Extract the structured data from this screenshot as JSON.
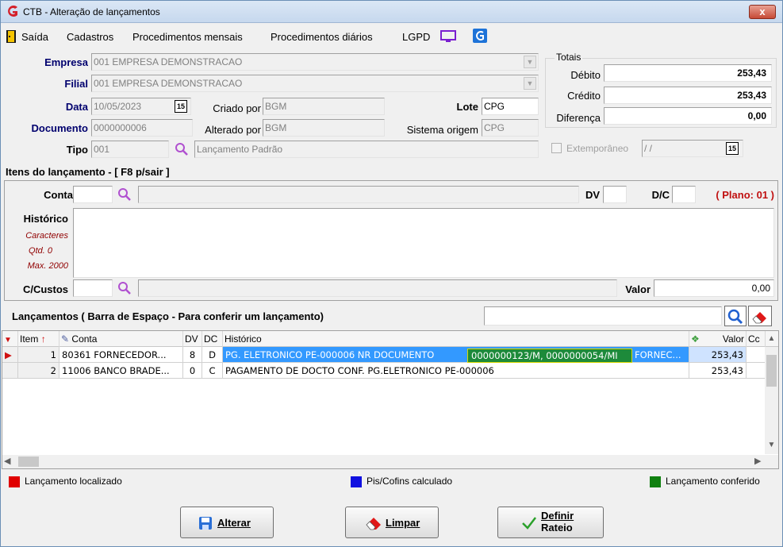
{
  "window": {
    "title": "CTB - Alteração de lançamentos",
    "close_label": "x"
  },
  "menu": [
    "Saída",
    "Cadastros",
    "Procedimentos mensais",
    "Procedimentos diários",
    "LGPD"
  ],
  "header": {
    "empresa_label": "Empresa",
    "empresa_value": "001 EMPRESA DEMONSTRACAO",
    "filial_label": "Filial",
    "filial_value": "001 EMPRESA DEMONSTRACAO",
    "data_label": "Data",
    "data_value": "10/05/2023",
    "criado_por_label": "Criado por",
    "criado_por_value": "BGM",
    "lote_label": "Lote",
    "lote_value": "CPG",
    "documento_label": "Documento",
    "documento_value": "0000000006",
    "alterado_por_label": "Alterado por",
    "alterado_por_value": "BGM",
    "sistema_origem_label": "Sistema origem",
    "sistema_origem_value": "CPG",
    "tipo_label": "Tipo",
    "tipo_value": "001",
    "tipo_desc": "Lançamento Padrão",
    "calendar_glyph": "15"
  },
  "totais": {
    "title": "Totais",
    "debito_label": "Débito",
    "debito_value": "253,43",
    "credito_label": "Crédito",
    "credito_value": "253,43",
    "diferenca_label": "Diferença",
    "diferenca_value": "0,00"
  },
  "extemporaneo": {
    "label": "Extemporâneo",
    "date_value": "/ /"
  },
  "itens": {
    "section_title": "Itens do lançamento - [ F8 p/sair ]",
    "conta_label": "Conta",
    "dv_label": "DV",
    "dc_label": "D/C",
    "plano_label": "( Plano: 01 )",
    "historico_label": "Histórico",
    "caracteres_label": "Caracteres",
    "qtd_label": "Qtd. 0",
    "max_label": "Max. 2000",
    "ccustos_label": "C/Custos",
    "valor_label": "Valor",
    "valor_value": "0,00"
  },
  "lancamentos": {
    "section_title": "Lançamentos ( Barra de Espaço - Para conferir um lançamento)",
    "search_value": "",
    "columns": [
      "Item",
      "Conta",
      "DV",
      "DC",
      "Histórico",
      "Valor",
      "Cc"
    ],
    "rows": [
      {
        "item": "1",
        "conta": "80361 FORNECEDOR...",
        "dv": "8",
        "dc": "D",
        "historico": "PG. ELETRONICO PE-000006  NR DOCUMENTO",
        "tooltip": "0000000123/M, 0000000054/MI",
        "historico_tail": "FORNEC...",
        "valor": "253,43"
      },
      {
        "item": "2",
        "conta": "11006 BANCO BRADE...",
        "dv": "0",
        "dc": "C",
        "historico": "PAGAMENTO DE DOCTO CONF. PG.ELETRONICO PE-000006",
        "tooltip": "",
        "historico_tail": "",
        "valor": "253,43"
      }
    ]
  },
  "legend": [
    {
      "label": "Lançamento localizado",
      "color": "#e00000"
    },
    {
      "label": "Pis/Cofins calculado",
      "color": "#1010e0"
    },
    {
      "label": "Lançamento conferido",
      "color": "#108010"
    }
  ],
  "buttons": {
    "alterar": "Alterar",
    "limpar": "Limpar",
    "definir_line1": "Definir",
    "definir_line2": "Rateio"
  },
  "colors": {
    "accent_red": "#c01010",
    "selection_blue": "#3399ff",
    "tooltip_green": "#1d8a3a",
    "navy_label": "#00006e"
  }
}
